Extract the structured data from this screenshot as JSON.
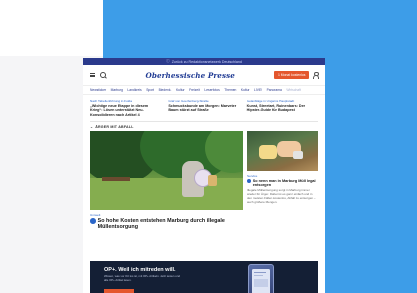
{
  "alert": {
    "text": "Zurück zu Redaktionsnetzwerk Deutschland"
  },
  "header": {
    "logo": "Oberhessische Presse",
    "cta_label": "1 Monat kostenlos"
  },
  "nav": {
    "items": [
      "Newsticker",
      "Marburg",
      "Landkreis",
      "Sport",
      "Biedenk.",
      "Kultur",
      "Freizeit",
      "Leserfotos",
      "Themen",
      "Kultur",
      "LIVE!",
      "Panorama"
    ],
    "last_item": "Wirtschaft"
  },
  "teasers": [
    {
      "kicker": "Nach Tabellenführung in Fulda",
      "title": "„Wichtige neue Etappe in diesem Krieg“: Lösen unterstützt Neu-Konsolidieren nach Artikel 4"
    },
    {
      "kicker": "Graf von Goerfenberg-Straße",
      "title": "Schmucksbunde am Morgen: Marveter Baum stürzt auf Straße"
    },
    {
      "kicker": "Gelanbläge in Ungarns Hauptstadt",
      "title": "Kunst, Streetart, Ruinenbars: Der Hipster-Guide für Budapest"
    }
  ],
  "section": {
    "title": "ÄRGER MIT ABFALL"
  },
  "main_article": {
    "kicker": "Umwelt",
    "title": "So hohe Kosten entstehen Marburg durch illegale Müllentsorgung"
  },
  "side_article": {
    "kicker": "Service",
    "title": "So nenn man in Marburg Müll legal entsorgen",
    "text": "Illegale Müllentsorgung sorgt in Marburg immer wieder für Ärger. Dabei ist es ganz einfach und in den meisten Fällen kostenlos, Abfall zu entsorgen – auch größere Mengen."
  },
  "promo": {
    "title": "OP+. Weil ich mitreden will.",
    "text": "Wissen, was vor Ort los ist, mit OP+ Artikeln. Jetzt testen und alle OP+ Artikel lesen."
  }
}
